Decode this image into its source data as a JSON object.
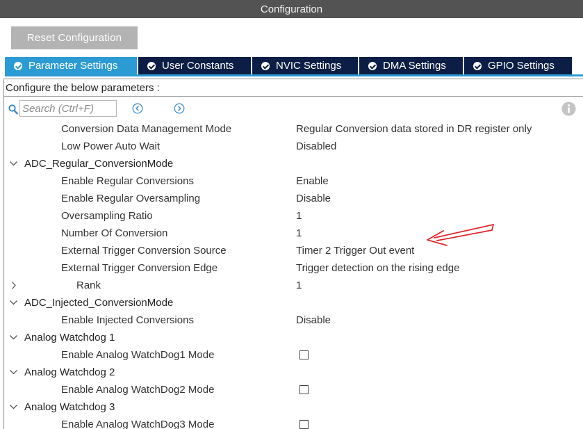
{
  "window": {
    "title": "Configuration"
  },
  "toolbar": {
    "reset_label": "Reset Configuration"
  },
  "tabs": [
    {
      "label": "Parameter Settings",
      "active": true
    },
    {
      "label": "User Constants",
      "active": false
    },
    {
      "label": "NVIC Settings",
      "active": false
    },
    {
      "label": "DMA Settings",
      "active": false
    },
    {
      "label": "GPIO Settings",
      "active": false
    }
  ],
  "panel": {
    "header": "Configure the below parameters :",
    "search_placeholder": "Search (Ctrl+F)"
  },
  "rows": [
    {
      "kind": "param",
      "label": "Conversion Data Management Mode",
      "value": "Regular Conversion data stored in DR register only"
    },
    {
      "kind": "param",
      "label": "Low Power Auto Wait",
      "value": "Disabled"
    },
    {
      "kind": "group",
      "label": "ADC_Regular_ConversionMode",
      "expanded": true
    },
    {
      "kind": "param",
      "label": "Enable Regular Conversions",
      "value": "Enable"
    },
    {
      "kind": "param",
      "label": "Enable Regular Oversampling",
      "value": "Disable"
    },
    {
      "kind": "param",
      "label": "Oversampling Ratio",
      "value": "1"
    },
    {
      "kind": "param",
      "label": "Number Of Conversion",
      "value": "1"
    },
    {
      "kind": "param",
      "label": "External Trigger Conversion Source",
      "value": "Timer 2 Trigger Out event"
    },
    {
      "kind": "param",
      "label": "External Trigger Conversion Edge",
      "value": "Trigger detection on the rising edge"
    },
    {
      "kind": "sub",
      "label": "Rank",
      "value": "1",
      "expanded": false
    },
    {
      "kind": "group",
      "label": "ADC_Injected_ConversionMode",
      "expanded": true
    },
    {
      "kind": "param",
      "label": "Enable Injected Conversions",
      "value": "Disable"
    },
    {
      "kind": "group",
      "label": "Analog Watchdog 1",
      "expanded": true
    },
    {
      "kind": "check",
      "label": "Enable Analog WatchDog1 Mode",
      "checked": false
    },
    {
      "kind": "group",
      "label": "Analog Watchdog 2",
      "expanded": true
    },
    {
      "kind": "check",
      "label": "Enable Analog WatchDog2 Mode",
      "checked": false
    },
    {
      "kind": "group",
      "label": "Analog Watchdog 3",
      "expanded": true
    },
    {
      "kind": "check",
      "label": "Enable Analog WatchDog3 Mode",
      "checked": false
    }
  ],
  "colors": {
    "tab_active": "#2c9bd3",
    "tab_inactive": "#0c1e45",
    "title_bar": "#535353",
    "annotation_arrow": "#e0262b"
  },
  "icons": {
    "search": "search-icon",
    "prev": "chevron-left-circle-icon",
    "next": "chevron-right-circle-icon",
    "info": "info-icon",
    "tab_status": "check-circle-icon",
    "expanded": "chevron-down-icon",
    "collapsed": "chevron-right-icon"
  }
}
